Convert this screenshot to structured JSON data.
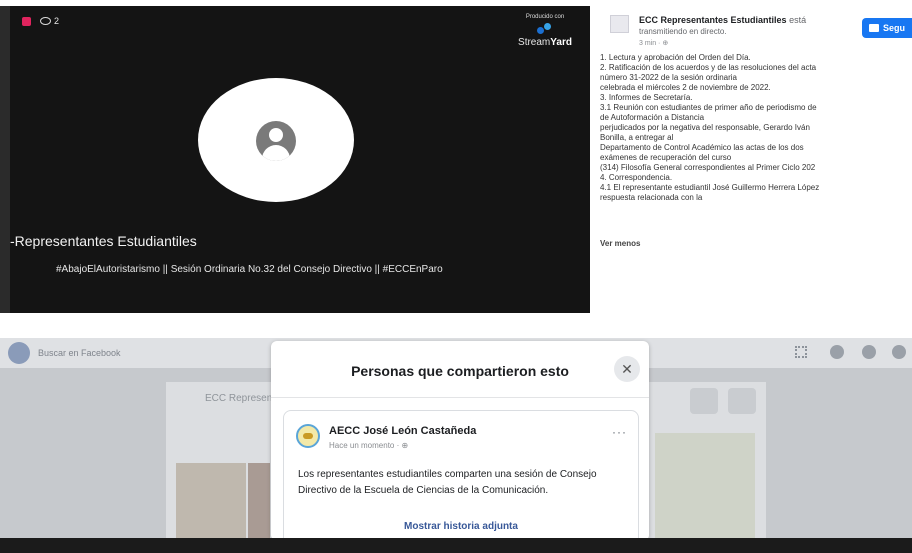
{
  "stream": {
    "viewer_count": "2",
    "produced_with": "Producido con",
    "brand_light": "Stream",
    "brand_bold": "Yard",
    "title": "-Representantes Estudiantiles",
    "ticker": "#AbajoElAutoristarismo || Sesión Ordinaria No.32 del Consejo Directivo || #ECCEnParo"
  },
  "post": {
    "page_name": "ECC Representantes Estudiantiles",
    "status_inline": "está",
    "status": "transmitiendo en directo.",
    "time": "3 min · ",
    "follow_label": "Segu",
    "lines": [
      "1. Lectura y aprobación del Orden del Día.",
      "2. Ratificación de los acuerdos y de las resoluciones del acta",
      "número 31-2022 de la sesión ordinaria",
      "celebrada el miércoles 2 de noviembre de 2022.",
      "3. Informes de Secretaría.",
      "3.1 Reunión con estudiantes de primer año de periodismo de",
      "de Autoformación a Distancia",
      "perjudicados por la negativa del responsable, Gerardo Iván",
      "Bonilla, a entregar al",
      "Departamento de Control Académico las actas de los dos",
      "exámenes de recuperación del curso",
      "(314) Filosofía General correspondientes al Primer Ciclo 202",
      "4. Correspondencia.",
      "4.1 El representante estudiantil José Guillermo Herrera López",
      "respuesta relacionada con la"
    ],
    "see_less": "Ver menos"
  },
  "facebook": {
    "search_placeholder": "Buscar en Facebook",
    "card_title": "ECC Represen"
  },
  "dialog": {
    "title": "Personas que compartieron esto",
    "close_symbol": "✕",
    "share": {
      "author": "AECC José León Castañeda",
      "time": "Hace un momento · ",
      "more": "···",
      "text": "Los representantes estudiantiles comparten una sesión de Consejo Directivo de la Escuela de Ciencias de la Comunicación.",
      "link": "Mostrar historia adjunta"
    }
  },
  "colors": {
    "accent": "#1877f2",
    "live": "#e0245e",
    "link": "#385898"
  }
}
